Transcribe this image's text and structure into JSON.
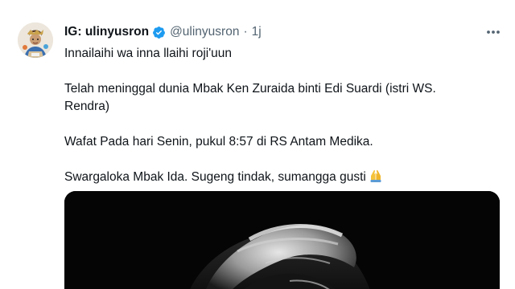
{
  "tweet": {
    "display_name": "IG: ulinyusron",
    "handle": "@ulinyusron",
    "separator": "·",
    "time": "1j",
    "verified": true,
    "icons": {
      "verified": "verified-badge-icon",
      "more": "more-options-icon",
      "emoji": "folded-hands-emoji"
    },
    "colors": {
      "verified": "#1d9bf0",
      "text": "#0f1419",
      "secondary": "#536471"
    },
    "paragraphs": {
      "p1": "Innailaihi wa inna llaihi roji'uun",
      "p2": "Telah meninggal dunia Mbak Ken Zuraida binti Edi Suardi (istri WS. Rendra)",
      "p3": "Wafat Pada hari Senin, pukul 8:57 di RS Antam Medika.",
      "p4": "Swargaloka Mbak Ida. Sugeng tindak, sumangga gusti"
    }
  }
}
